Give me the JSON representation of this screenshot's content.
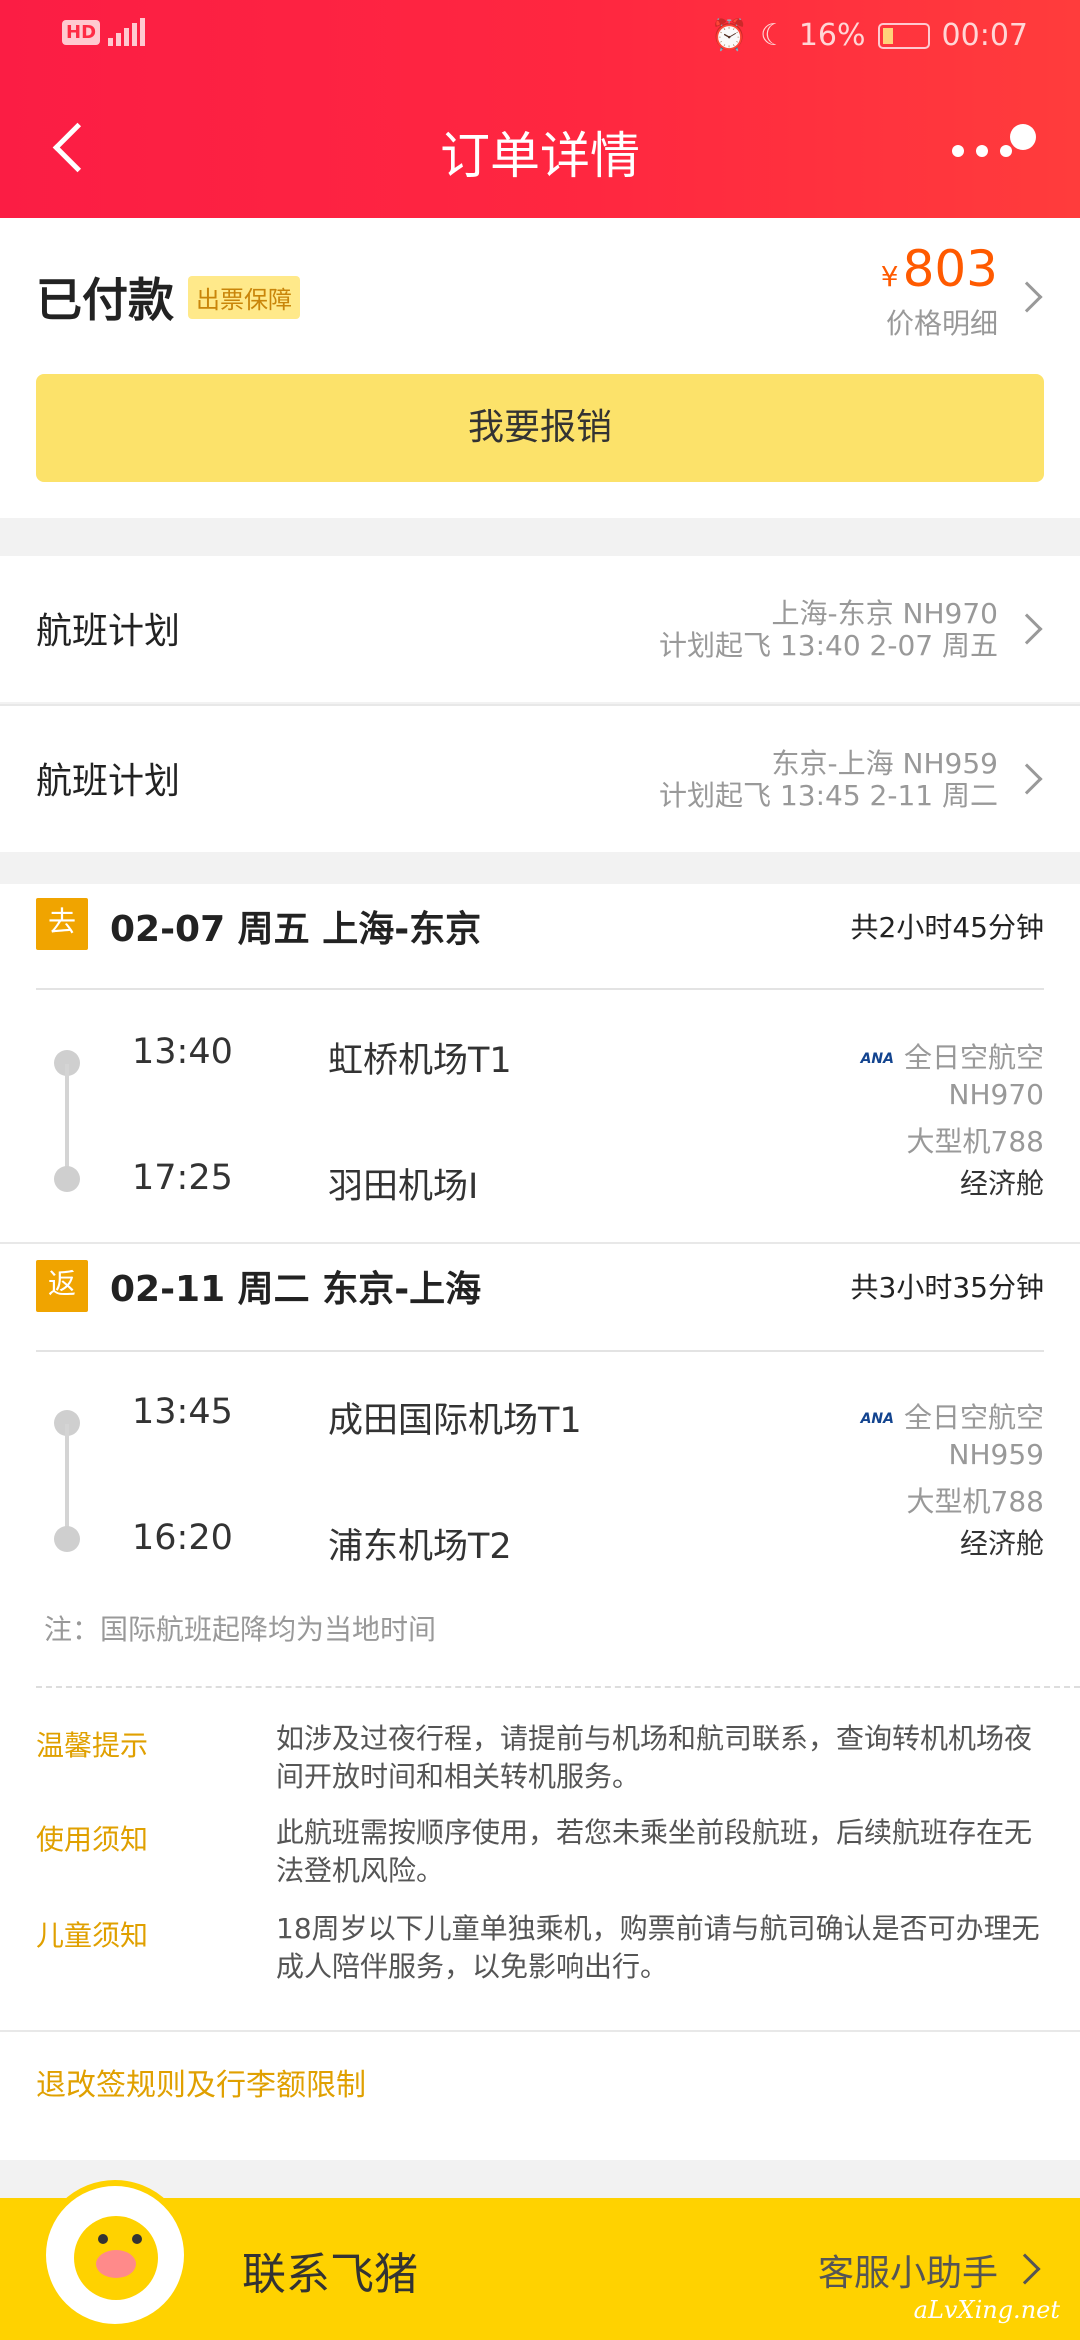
{
  "status_bar": {
    "left": "HD 4G",
    "battery": "16%",
    "time": "00:07"
  },
  "nav": {
    "title": "订单详情"
  },
  "order": {
    "status": "已付款",
    "tag": "出票保障",
    "currency": "¥",
    "price": "803",
    "price_detail": "价格明细",
    "reimburse_label": "我要报销"
  },
  "flight_plans": [
    {
      "label": "航班计划",
      "route": "上海-东京 NH970",
      "schedule": "计划起飞 13:40 2-07 周五"
    },
    {
      "label": "航班计划",
      "route": "东京-上海 NH959",
      "schedule": "计划起飞 13:45 2-11 周二"
    }
  ],
  "legs": [
    {
      "badge": "去",
      "title": "02-07 周五 上海-东京",
      "duration": "共2小时45分钟",
      "dep_time": "13:40",
      "dep_airport": "虹桥机场T1",
      "arr_time": "17:25",
      "arr_airport": "羽田机场I",
      "airline_logo": "ANA",
      "airline": "全日空航空",
      "flight_no": "NH970",
      "aircraft": "大型机788",
      "cabin": "经济舱"
    },
    {
      "badge": "返",
      "title": "02-11 周二 东京-上海",
      "duration": "共3小时35分钟",
      "dep_time": "13:45",
      "dep_airport": "成田国际机场T1",
      "arr_time": "16:20",
      "arr_airport": "浦东机场T2",
      "airline_logo": "ANA",
      "airline": "全日空航空",
      "flight_no": "NH959",
      "aircraft": "大型机788",
      "cabin": "经济舱"
    }
  ],
  "note": "注：国际航班起降均为当地时间",
  "tips": [
    {
      "label": "温馨提示",
      "text": "如涉及过夜行程，请提前与机场和航司联系，查询转机机场夜间开放时间和相关转机服务。"
    },
    {
      "label": "使用须知",
      "text": "此航班需按顺序使用，若您未乘坐前段航班，后续航班存在无法登机风险。"
    },
    {
      "label": "儿童须知",
      "text": "18周岁以下儿童单独乘机，购票前请与航司确认是否可办理无成人陪伴服务，以免影响出行。"
    }
  ],
  "rules_link": "退改签规则及行李额限制",
  "bottom": {
    "contact": "联系飞猪",
    "service": "客服小助手"
  },
  "watermark": "aLvXing.net",
  "colors": {
    "header_red": "#fb1d44",
    "accent_orange": "#ff5a00",
    "reimburse_yellow": "#fce26a",
    "tip_gold": "#e0a000",
    "bottom_yellow": "#ffd200"
  }
}
